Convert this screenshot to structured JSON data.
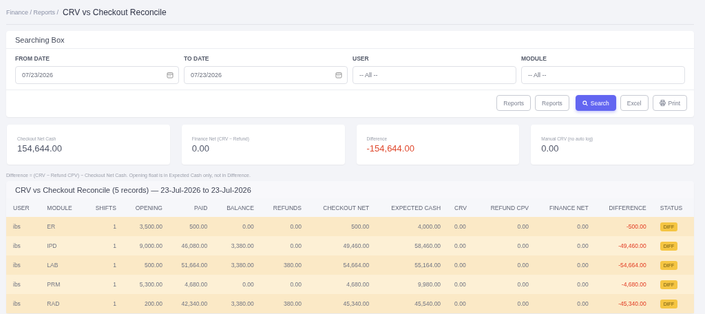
{
  "breadcrumb": {
    "trail": "Finance / Reports /",
    "title": "CRV vs Checkout Reconcile"
  },
  "search_box": {
    "title": "Searching Box",
    "fields": [
      {
        "label": "FROM DATE",
        "kind": "date",
        "value": "07/23/2026"
      },
      {
        "label": "TO DATE",
        "kind": "date",
        "value": "07/23/2026"
      },
      {
        "label": "USER",
        "kind": "select",
        "value": "-- All --"
      },
      {
        "label": "MODULE",
        "kind": "select",
        "value": "-- All --"
      }
    ],
    "buttons": [
      {
        "label": "Reports",
        "kind": "outline"
      },
      {
        "label": "Reports",
        "kind": "outline"
      },
      {
        "label": "Search",
        "kind": "primary"
      },
      {
        "label": "Excel",
        "kind": "outline"
      },
      {
        "label": "Print",
        "kind": "print"
      }
    ]
  },
  "stats": [
    {
      "label": "Checkout Net Cash",
      "value": "154,644.00",
      "kind": "normal"
    },
    {
      "label": "Finance Net (CRV − Refund)",
      "value": "0.00",
      "kind": "normal"
    },
    {
      "label": "Difference",
      "value": "-154,644.00",
      "kind": "negative"
    },
    {
      "label": "Manual CRV (no auto log)",
      "value": "0.00",
      "kind": "normal"
    }
  ],
  "note": "Difference = (CRV − Refund CPV) − Checkout Net Cash. Opening float is in Expected Cash only, not in Difference.",
  "table": {
    "title": "CRV vs Checkout Reconcile (5 records) — 23-Jul-2026 to 23-Jul-2026",
    "columns": [
      {
        "label": "USER",
        "kind": "text"
      },
      {
        "label": "MODULE",
        "kind": "text"
      },
      {
        "label": "SHIFTS",
        "kind": "number"
      },
      {
        "label": "OPENING",
        "kind": "number"
      },
      {
        "label": "PAID",
        "kind": "number"
      },
      {
        "label": "BALANCE",
        "kind": "number"
      },
      {
        "label": "REFUNDS",
        "kind": "number"
      },
      {
        "label": "CHECKOUT NET",
        "kind": "number"
      },
      {
        "label": "EXPECTED CASH",
        "kind": "number"
      },
      {
        "label": "CRV",
        "kind": "text"
      },
      {
        "label": "REFUND CPV",
        "kind": "number"
      },
      {
        "label": "FINANCE NET",
        "kind": "number"
      },
      {
        "label": "DIFFERENCE",
        "kind": "difference"
      },
      {
        "label": "STATUS",
        "kind": "status"
      }
    ],
    "rows": [
      [
        "ibs",
        "ER",
        "1",
        "3,500.00",
        "500.00",
        "0.00",
        "0.00",
        "500.00",
        "4,000.00",
        "0.00",
        "0.00",
        "0.00",
        "-500.00",
        "DIFF"
      ],
      [
        "ibs",
        "IPD",
        "1",
        "9,000.00",
        "46,080.00",
        "3,380.00",
        "0.00",
        "49,460.00",
        "58,460.00",
        "0.00",
        "0.00",
        "0.00",
        "-49,460.00",
        "DIFF"
      ],
      [
        "ibs",
        "LAB",
        "1",
        "500.00",
        "51,664.00",
        "3,380.00",
        "380.00",
        "54,664.00",
        "55,164.00",
        "0.00",
        "0.00",
        "0.00",
        "-54,664.00",
        "DIFF"
      ],
      [
        "ibs",
        "PRM",
        "1",
        "5,300.00",
        "4,680.00",
        "0.00",
        "0.00",
        "4,680.00",
        "9,980.00",
        "0.00",
        "0.00",
        "0.00",
        "-4,680.00",
        "DIFF"
      ],
      [
        "ibs",
        "RAD",
        "1",
        "200.00",
        "42,340.00",
        "3,380.00",
        "380.00",
        "45,340.00",
        "45,540.00",
        "0.00",
        "0.00",
        "0.00",
        "-45,340.00",
        "DIFF"
      ]
    ]
  }
}
